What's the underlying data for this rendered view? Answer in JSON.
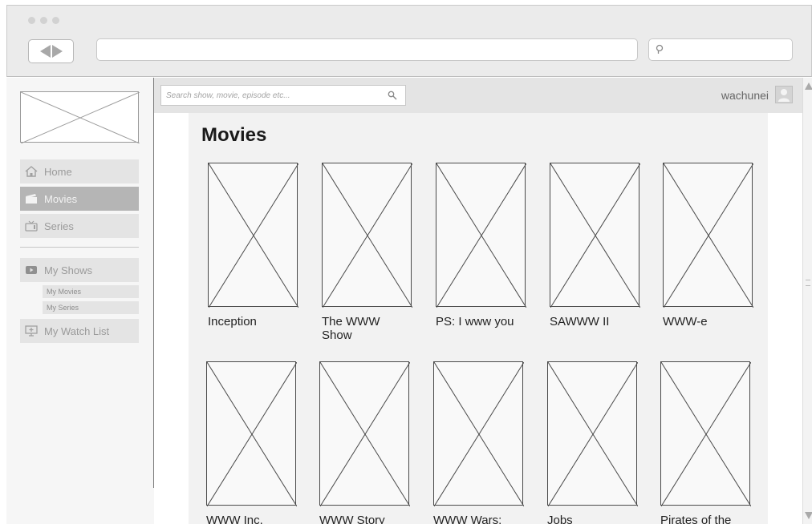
{
  "search": {
    "placeholder": "Search show, movie, episode etc..."
  },
  "user": {
    "name": "wachunei"
  },
  "nav": {
    "items": [
      {
        "label": "Home",
        "icon": "home-icon"
      },
      {
        "label": "Movies",
        "icon": "clapperboard-icon",
        "active": true
      },
      {
        "label": "Series",
        "icon": "tv-icon"
      },
      {
        "label": "My Shows",
        "icon": "play-icon"
      },
      {
        "label": "My Watch List",
        "icon": "monitor-icon"
      }
    ],
    "subitems": [
      {
        "label": "My Movies"
      },
      {
        "label": "My Series"
      }
    ]
  },
  "main": {
    "title": "Movies",
    "movies": [
      {
        "title": "Inception"
      },
      {
        "title": "The WWW Show"
      },
      {
        "title": "PS: I www you"
      },
      {
        "title": "SAWWW II"
      },
      {
        "title": "WWW-e"
      },
      {
        "title": "WWW Inc."
      },
      {
        "title": "WWW Story"
      },
      {
        "title": "WWW Wars:"
      },
      {
        "title": "Jobs"
      },
      {
        "title": "Pirates of the"
      }
    ]
  },
  "colors": {
    "active_nav": "#b5b5b5",
    "topbar": "#e4e4e4",
    "content_bg": "#f2f2f2"
  }
}
